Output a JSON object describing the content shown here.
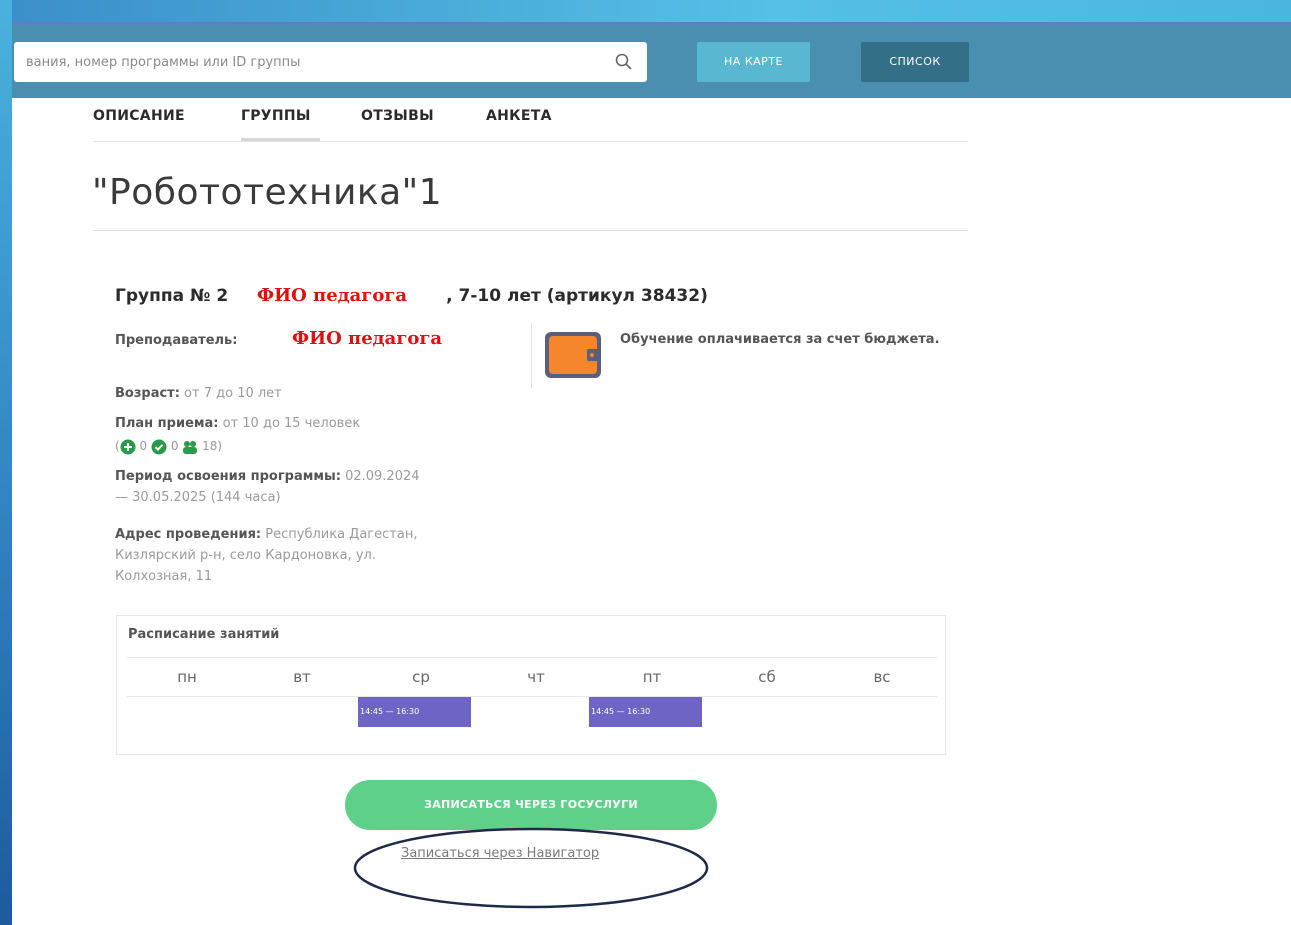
{
  "header": {
    "search_placeholder": "вания, номер программы или ID группы",
    "map_button": "НА КАРТЕ",
    "list_button": "СПИСОК"
  },
  "tabs": [
    {
      "label": "ОПИСАНИЕ",
      "active": false
    },
    {
      "label": "ГРУППЫ",
      "active": true
    },
    {
      "label": "ОТЗЫВЫ",
      "active": false
    },
    {
      "label": "АНКЕТА",
      "active": false
    }
  ],
  "program": {
    "title": "\"Робототехника\"1"
  },
  "group": {
    "heading_prefix": "Группа № 2",
    "heading_suffix": ", 7-10 лет (артикул 38432)",
    "teacher_label": "Преподаватель:",
    "fio_overlay_1": "ФИО педагога",
    "fio_overlay_2": "ФИО педагога",
    "age_label": "Возраст:",
    "age_value": " от 7 до 10 лет",
    "plan_label": "План приема:",
    "plan_value": " от 10 до 15 человек",
    "badges": {
      "open": "0",
      "enrolled": "0",
      "total": "18)"
    },
    "period_label": "Период освоения программы:",
    "period_value_1": " 02.09.2024",
    "period_value_2": "— 30.05.2025 (144 часа)",
    "address_label": "Адрес проведения:",
    "address_value_1": " Республика Дагестан,",
    "address_value_2": "Кизлярский р-н, село Кардоновка, ул.",
    "address_value_3": "Колхозная, 11",
    "budget_text": "Обучение оплачивается за счет бюджета."
  },
  "schedule": {
    "title": "Расписание занятий",
    "days": [
      "пн",
      "вт",
      "ср",
      "чт",
      "пт",
      "сб",
      "вс"
    ],
    "slots": [
      {
        "day": "ср",
        "time": "14:45 — 16:30"
      },
      {
        "day": "пт",
        "time": "14:45 — 16:30"
      }
    ]
  },
  "actions": {
    "gosuslugi_button": "ЗАПИСАТЬСЯ ЧЕРЕЗ ГОСУСЛУГИ",
    "navigator_link": "Записаться через Навигатор"
  },
  "colors": {
    "header_bg": "#4a8fb0",
    "map_button": "#5ab7d2",
    "list_button": "#346f88",
    "slot_bg": "#6e64c6",
    "gosuslugi_button": "#5fd08a",
    "overlay_text": "#e01010"
  }
}
